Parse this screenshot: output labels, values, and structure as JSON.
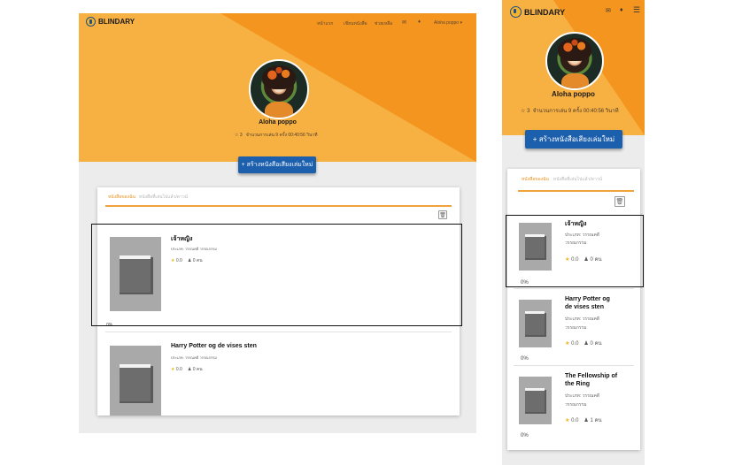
{
  "brand": "BLINDARY",
  "colors": {
    "accent": "#f4951f",
    "accent_dark": "#f7b042",
    "button": "#1b5fad",
    "star": "#f1b51c",
    "tab_active": "#e8911f"
  },
  "nav": {
    "items": [
      "หน้าแรก",
      "เขียนหนังสือ",
      "ช่วยเหลือ"
    ],
    "mail_icon": "envelope-icon",
    "bell_icon": "bell-icon",
    "user_label": "Aloha poppo",
    "menu_icon": "hamburger-icon"
  },
  "profile": {
    "name": "Aloha poppo",
    "star_count": "3",
    "desktop_stats": "จำนวนการเล่น 9 ครั้ง 00:40:56 วินาที",
    "mobile_stats": "จำนวนการเล่น 9 ครั้ง 00:40:56 วินาที"
  },
  "create_button": "+ สร้างหนังสือเสียงเล่มใหม่",
  "tabs": [
    "หนังสือของฉัน",
    "หนังสือที่เล่นไปแล้ว/ดาวน์"
  ],
  "trash_icon": "trash-icon",
  "desktop_books": [
    {
      "title": "เจ้าหญิง",
      "meta": "ประเภท: วรรณคดี วรรณกรรม",
      "rating": "0.0",
      "users": "0 คน",
      "progress": "0%"
    },
    {
      "title": "Harry Potter og de vises sten",
      "meta": "ประเภท: วรรณคดี วรรณกรรม",
      "rating": "0.0",
      "users": "0 คน",
      "progress": ""
    }
  ],
  "mobile_books": [
    {
      "title": "เจ้าหญิง",
      "meta1": "ประเภท: วรรณคดี",
      "meta2": "วรรณกรรม",
      "rating": "0.0",
      "users": "0 คน",
      "progress": "0%"
    },
    {
      "title1": "Harry Potter og",
      "title2": "de vises sten",
      "meta1": "ประเภท: วรรณคดี",
      "meta2": "วรรณกรรม",
      "rating": "0.0",
      "users": "0 คน",
      "progress": "0%"
    },
    {
      "title1": "The Fellowship of",
      "title2": "the Ring",
      "meta1": "ประเภท: วรรณคดี",
      "meta2": "วรรณกรรม",
      "rating": "0.0",
      "users": "1 คน",
      "progress": "0%"
    }
  ]
}
